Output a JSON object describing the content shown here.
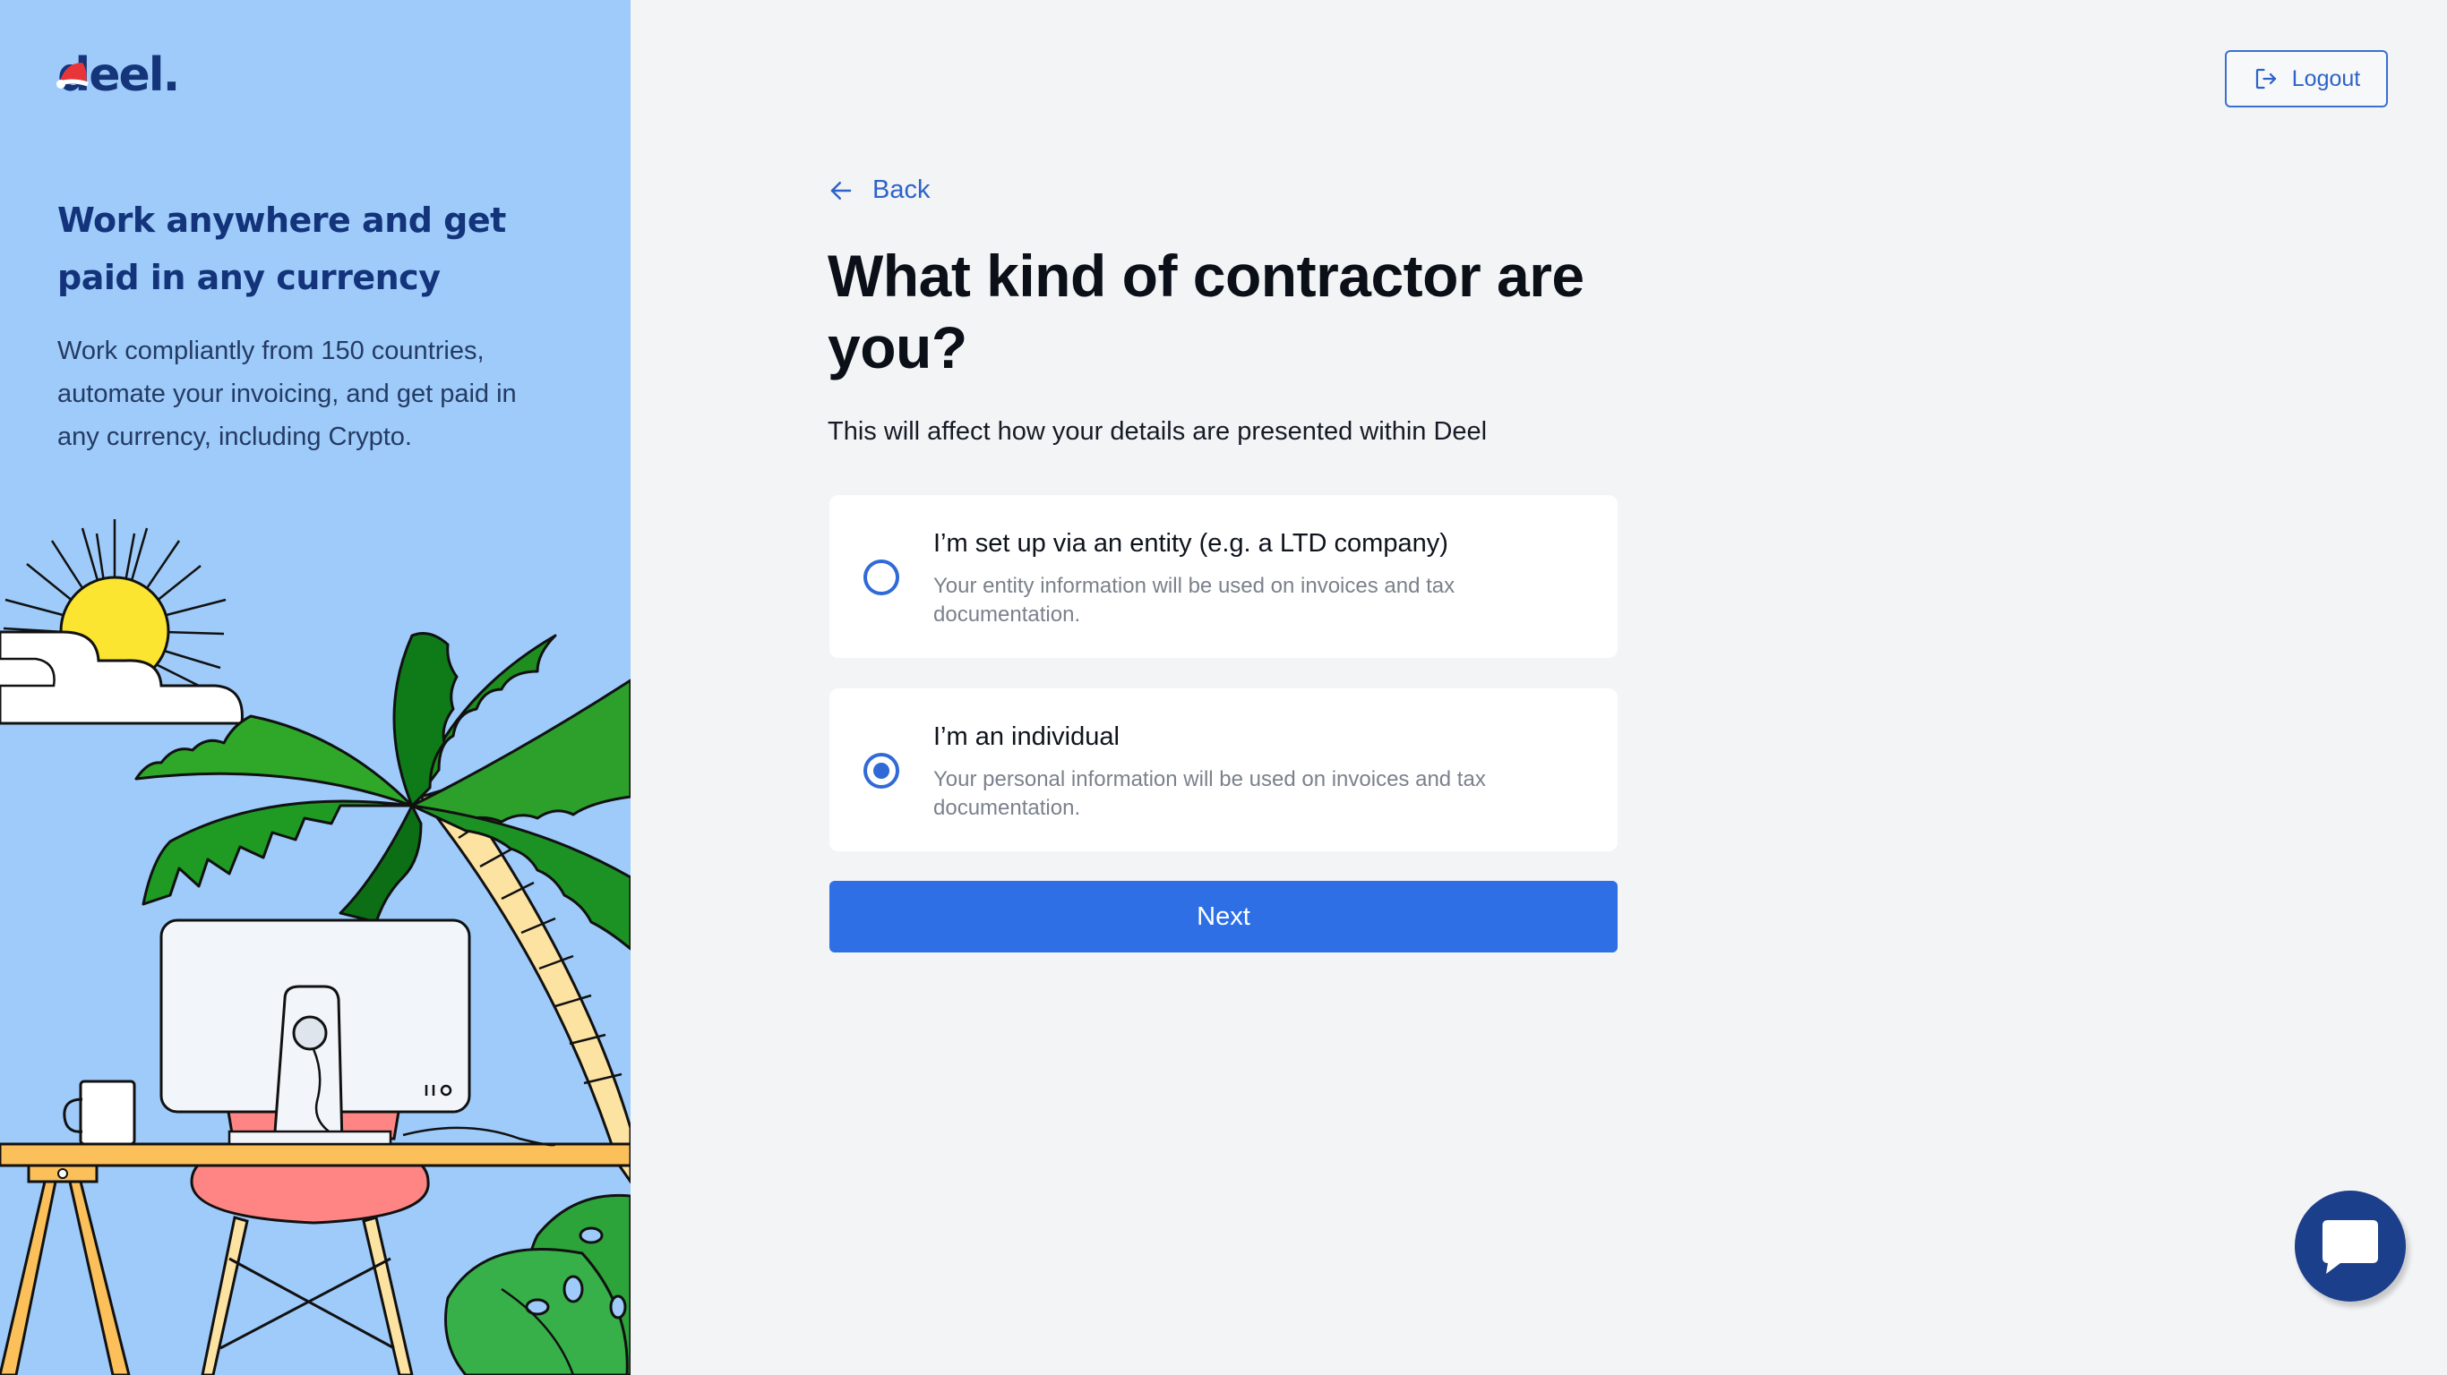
{
  "brand": {
    "logo_text": "deel."
  },
  "promo": {
    "title": "Work anywhere and get paid in any currency",
    "text": "Work compliantly from 150 countries, automate your invoicing, and get paid in any currency, including Crypto."
  },
  "header": {
    "logout_label": "Logout"
  },
  "nav": {
    "back_label": "Back"
  },
  "form": {
    "title": "What kind of contractor are you?",
    "subtitle": "This will affect how your details are presented within Deel",
    "options": [
      {
        "title": "I’m set up via an entity (e.g. a LTD company)",
        "description": "Your entity information will be used on invoices and tax documentation.",
        "selected": false
      },
      {
        "title": "I’m an individual",
        "description": "Your personal information will be used on invoices and tax documentation.",
        "selected": true
      }
    ],
    "next_label": "Next"
  },
  "colors": {
    "accent": "#2e6fe6",
    "brand_navy": "#13337a",
    "panel_blue": "#9ecbfa"
  },
  "icons": {
    "logout": "logout-icon",
    "back": "arrow-left-icon",
    "chat": "chat-icon"
  }
}
